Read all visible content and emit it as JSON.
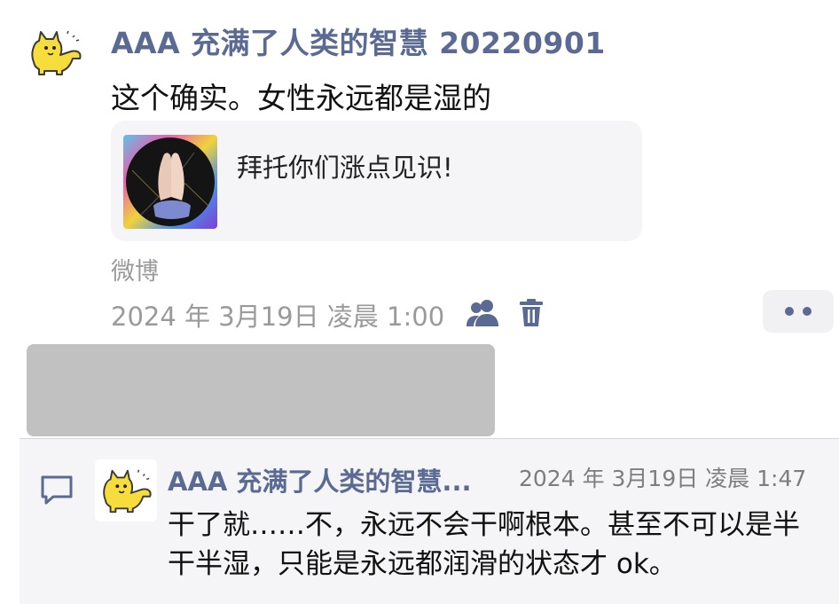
{
  "post": {
    "author": "AAA 充满了人类的智慧 20220901",
    "text": "这个确实。女性永远都是湿的",
    "avatar_icon": "yellow-cat-icon",
    "link_card": {
      "title": "拜托你们涨点见识!",
      "thumbnail_icon": "praying-hands-image"
    },
    "source": "微博",
    "timestamp": "2024 年 3月19日 凌晨 1:00",
    "visibility_icon": "people-icon",
    "delete_icon": "trash-icon",
    "more_icon": "more-dots-icon"
  },
  "comment": {
    "icon": "comment-bubble-icon",
    "author": "AAA 充满了人类的智慧...",
    "timestamp": "2024 年 3月19日 凌晨 1:47",
    "text": "干了就……不，永远不会干啊根本。甚至不可以是半干半湿，只能是永远都润滑的状态才 ok。"
  },
  "colors": {
    "author": "#5a6a93",
    "meta": "#9a9a9a",
    "card_bg": "#f5f5f7",
    "redacted": "#c1c1c1"
  }
}
